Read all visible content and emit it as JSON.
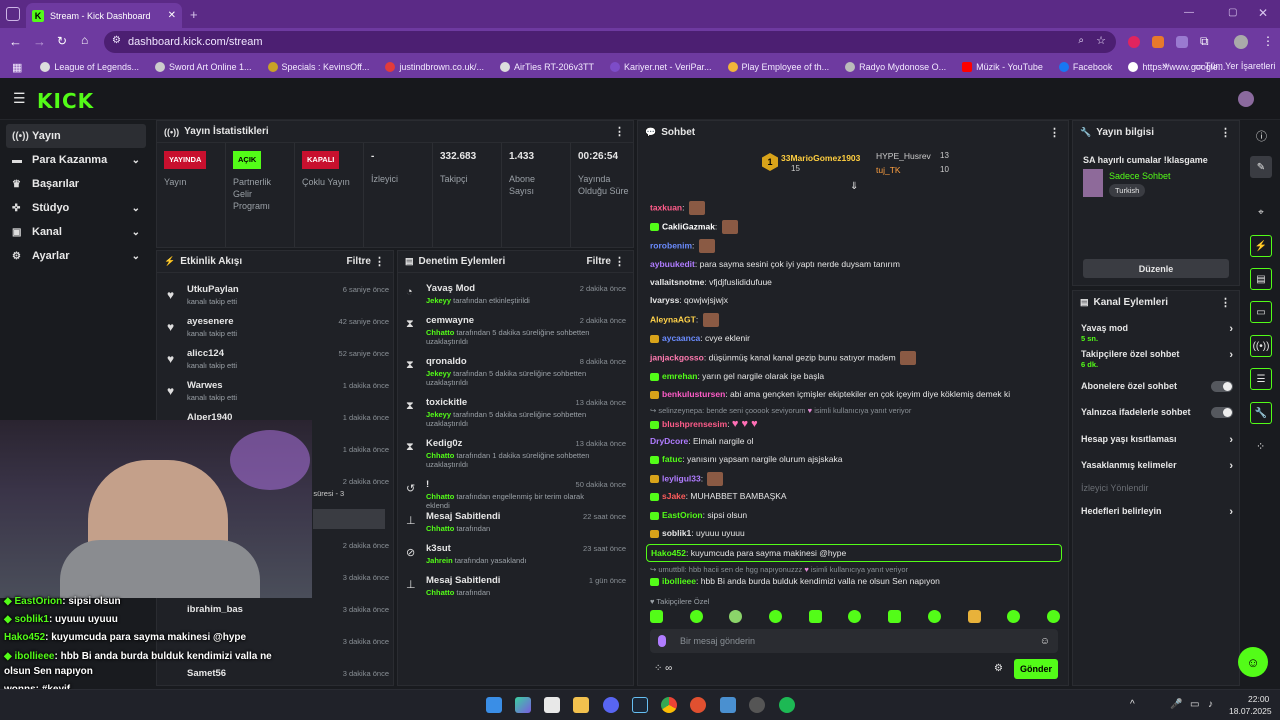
{
  "browser": {
    "tab_title": "Stream - Kick Dashboard",
    "url": "dashboard.kick.com/stream",
    "bookmarks": [
      "League of Legends...",
      "Sword Art Online 1...",
      "Specials : KevinsOff...",
      "justindbrown.co.uk/...",
      "AirTies RT-206v3TT",
      "Kariyer.net - VeriPar...",
      "Play Employee of th...",
      "Radyo Mydonose O...",
      "Müzik - YouTube",
      "Facebook",
      "https://www.google..."
    ],
    "bookmarks_folder": "Tüm Yer İşaretleri"
  },
  "header": {
    "logo": "KICK"
  },
  "sidebar": {
    "items": [
      {
        "label": "Yayın",
        "icon": "broadcast-icon"
      },
      {
        "label": "Para Kazanma",
        "icon": "money-icon"
      },
      {
        "label": "Başarılar",
        "icon": "trophy-icon"
      },
      {
        "label": "Stüdyo",
        "icon": "studio-icon"
      },
      {
        "label": "Kanal",
        "icon": "channel-icon"
      },
      {
        "label": "Ayarlar",
        "icon": "gear-icon"
      }
    ]
  },
  "stats": {
    "title": "Yayın İstatistikleri",
    "cols": [
      {
        "badge": "YAYINDA",
        "label": "Yayın"
      },
      {
        "badge": "AÇIK",
        "label": "Partnerlik Gelir Programı"
      },
      {
        "badge": "KAPALI",
        "label": "Çoklu Yayın"
      },
      {
        "value": "-",
        "label": "İzleyici"
      },
      {
        "value": "332.683",
        "label": "Takipçi"
      },
      {
        "value": "1.433",
        "label": "Abone Sayısı"
      },
      {
        "value": "00:26:54",
        "label": "Yayında Olduğu Süre"
      }
    ]
  },
  "activity": {
    "title": "Etkinlik Akışı",
    "filter": "Filtre",
    "items": [
      {
        "name": "UtkuPaylan",
        "sub": "kanalı takip etti",
        "time": "6 saniye önce"
      },
      {
        "name": "ayesenere",
        "sub": "kanalı takip etti",
        "time": "42 saniye önce"
      },
      {
        "name": "alicc124",
        "sub": "kanalı takip etti",
        "time": "52 saniye önce"
      },
      {
        "name": "Warwes",
        "sub": "kanalı takip etti",
        "time": "1 dakika önce"
      },
      {
        "name": "Alper1940",
        "sub": "",
        "time": "1 dakika önce"
      },
      {
        "name": "",
        "sub": "",
        "time": "1 dakika önce"
      },
      {
        "name": "",
        "sub": "m abonelik süresi - 3",
        "time": "2 dakika önce"
      },
      {
        "name": "",
        "sub": "",
        "time": ""
      },
      {
        "name": "",
        "sub": "",
        "time": "2 dakika önce"
      },
      {
        "name": "",
        "sub": "",
        "time": "3 dakika önce"
      },
      {
        "name": "ibrahim_bas",
        "sub": "",
        "time": "3 dakika önce"
      },
      {
        "name": "",
        "sub": "",
        "time": "3 dakika önce"
      },
      {
        "name": "Samet56",
        "sub": "",
        "time": "3 dakika önce"
      }
    ]
  },
  "moderation": {
    "title": "Denetim Eylemleri",
    "filter": "Filtre",
    "items": [
      {
        "icon": "speedometer-icon",
        "name": "Yavaş Mod",
        "actor": "Jekeyy",
        "sub": " tarafından etkinleştirildi",
        "time": "2 dakika önce"
      },
      {
        "icon": "hourglass-icon",
        "name": "cemwayne",
        "actor": "Chhatto",
        "sub": " tarafından 5 dakika süreliğine sohbetten uzaklaştırıldı",
        "time": "2 dakika önce"
      },
      {
        "icon": "hourglass-icon",
        "name": "qronaldo",
        "actor": "Jekeyy",
        "sub": " tarafından 5 dakika süreliğine sohbetten uzaklaştırıldı",
        "time": "8 dakika önce"
      },
      {
        "icon": "hourglass-icon",
        "name": "toxickitle",
        "actor": "Jekeyy",
        "sub": " tarafından 5 dakika süreliğine sohbetten uzaklaştırıldı",
        "time": "13 dakika önce"
      },
      {
        "icon": "hourglass-icon",
        "name": "Kedig0z",
        "actor": "Chhatto",
        "sub": " tarafından 1 dakika süreliğine sohbetten uzaklaştırıldı",
        "time": "13 dakika önce"
      },
      {
        "icon": "undo-icon",
        "name": "!",
        "actor": "Chhatto",
        "sub": " tarafından engellenmiş bir terim olarak eklendi",
        "time": "50 dakika önce"
      },
      {
        "icon": "pin-icon",
        "name": "Mesaj Sabitlendi",
        "actor": "Chhatto",
        "sub": " tarafından",
        "time": "22 saat önce"
      },
      {
        "icon": "ban-icon",
        "name": "k3sut",
        "actor": "Jahrein",
        "sub": " tarafından yasaklandı",
        "time": "23 saat önce"
      },
      {
        "icon": "pin-icon",
        "name": "Mesaj Sabitlendi",
        "actor": "Chhatto",
        "sub": " tarafından",
        "time": "1 gün önce"
      }
    ]
  },
  "chat": {
    "title": "Sohbet",
    "leaders": [
      {
        "rank": "1",
        "name": "33MarioGomez1903",
        "count": "15"
      },
      {
        "name": "HYPE_Husrev",
        "count": "13"
      },
      {
        "name": "tuj_TK",
        "count": "10"
      }
    ],
    "messages": [
      {
        "user": "taxkuan",
        "color": "#ff5c8a",
        "text": ""
      },
      {
        "user": "CakliGazmak",
        "color": "#ffffff",
        "text": ""
      },
      {
        "user": "rorobenim",
        "color": "#6b8cff",
        "text": ""
      },
      {
        "user": "aybuukedit",
        "color": "#b07cff",
        "text": "para sayma sesini çok iyi yaptı nerde duysam tanırım"
      },
      {
        "user": "vallaitsnotme",
        "color": "#ffffff",
        "text": "vfjdjfuslididufuue"
      },
      {
        "user": "lvaryss",
        "color": "#ffffff",
        "text": "qowjwjsjwjx"
      },
      {
        "user": "AleynaAGT",
        "color": "#ffd24a",
        "text": ""
      },
      {
        "user": "aycaanca",
        "color": "#6b8cff",
        "text": "cvye eklenir"
      },
      {
        "user": "janjackgosso",
        "color": "#ff7ab0",
        "text": "düşünmüş kanal kanal gezip bunu satıyor madem"
      },
      {
        "user": "emrehan",
        "color": "#53fc18",
        "text": "yarın gel nargile olarak işe başla"
      },
      {
        "user": "benkulustursen",
        "color": "#ff5cc8",
        "text": "abi ama gençken içmişler ekiptekiler en çok içeyim diye köklemiş demek ki"
      },
      {
        "user": "blushprensesim",
        "color": "#ff5c8a",
        "text": ""
      },
      {
        "user": "DryDcore",
        "color": "#b07cff",
        "text": "Elmalı nargile ol"
      },
      {
        "user": "fatuc",
        "color": "#53fc18",
        "text": "yanısını yapsam nargile olurum ajsjskaka"
      },
      {
        "user": "leyligul33",
        "color": "#b07cff",
        "text": ""
      },
      {
        "user": "sJake",
        "color": "#ff5c5c",
        "text": "MUHABBET BAMBAŞKA"
      },
      {
        "user": "EastOrion",
        "color": "#53fc18",
        "text": "sipsi olsun"
      },
      {
        "user": "soblik1",
        "color": "#ffffff",
        "text": "uyuuu uyuuu"
      },
      {
        "user": "Hako452",
        "color": "#53fc18",
        "text": "kuyumcuda para sayma makinesi @hype"
      },
      {
        "user": "ibollieee",
        "color": "#53fc18",
        "text": "hbb Bi anda burda bulduk kendimizi valla ne olsun Sen napıyon"
      }
    ],
    "reply1": "selinzeynepa: bende seni çooook seviyorum",
    "reply1_tail": "isimli kullanıcıya yanıt veriyor",
    "reply2": "umuttbll: hbb hacii sen de hgg napıyonuzzz",
    "reply2_tail": "isimli kullanıcıya yanıt veriyor",
    "followers_only": "Takipçilere Özel",
    "input_placeholder": "Bir mesaj gönderin",
    "send": "Gönder"
  },
  "stream_info": {
    "title": "Yayın bilgisi",
    "stream_title": "SA hayırlı cumalar !klasgame",
    "category": "Sadece Sohbet",
    "tag": "Turkish",
    "edit": "Düzenle"
  },
  "channel_actions": {
    "title": "Kanal Eylemleri",
    "items": [
      {
        "label": "Yavaş mod",
        "sub": "5 sn.",
        "type": "chevron"
      },
      {
        "label": "Takipçilere özel sohbet",
        "sub": "6 dk.",
        "type": "chevron"
      },
      {
        "label": "Abonelere özel sohbet",
        "type": "toggle"
      },
      {
        "label": "Yalnızca ifadelerle sohbet",
        "type": "toggle"
      },
      {
        "label": "Hesap yaşı kısıtlaması",
        "type": "chevron"
      },
      {
        "label": "Yasaklanmış kelimeler",
        "type": "chevron"
      },
      {
        "label": "İzleyici Yönlendir",
        "type": "disabled"
      },
      {
        "label": "Hedefleri belirleyin",
        "type": "chevron"
      }
    ]
  },
  "overlay_chat": [
    {
      "user": "EastOrion",
      "color": "#53fc18",
      "text": ": sipsi olsun"
    },
    {
      "user": "soblik1",
      "color": "#53fc18",
      "text": ": uyuuu uyuuu"
    },
    {
      "user": "Hako452",
      "color": "#53fc18",
      "text": ": kuyumcuda para sayma makinesi @hype"
    },
    {
      "user": "ibollieee",
      "color": "#53fc18",
      "text": ": hbb Bi anda burda bulduk kendimizi valla ne"
    },
    {
      "user": "",
      "color": "#ffffff",
      "text": "olsun Sen napıyon"
    },
    {
      "user": "wonns",
      "color": "#ffffff",
      "text": ": #keyif"
    }
  ],
  "taskbar": {
    "time": "22:00",
    "date": "18.07.2025"
  }
}
